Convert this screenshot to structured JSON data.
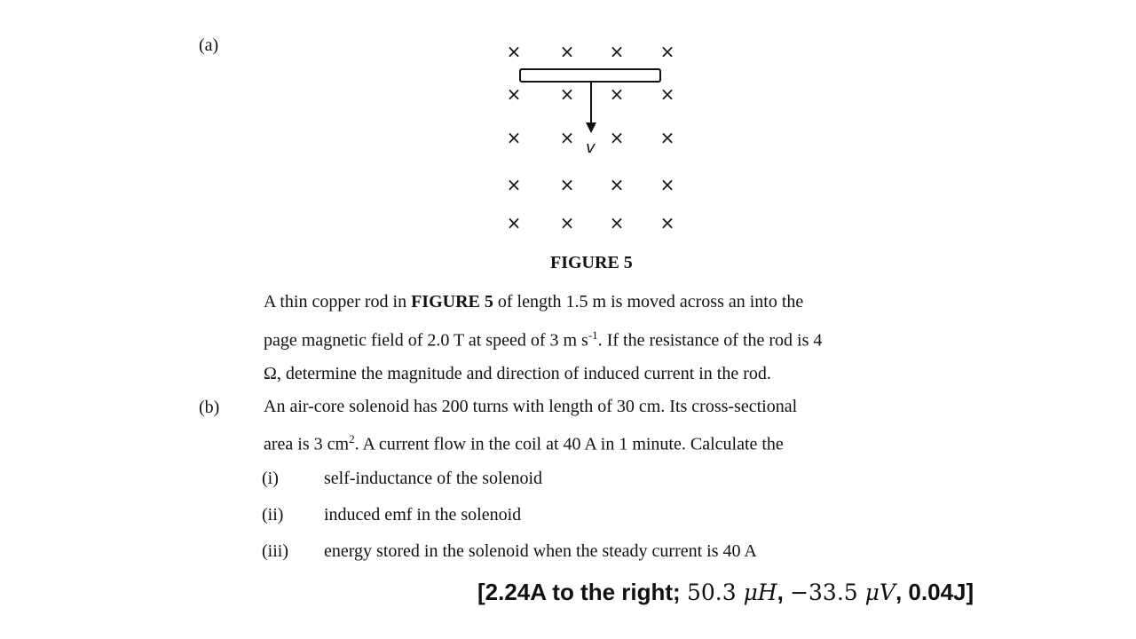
{
  "part_a": {
    "label": "(a)",
    "figure": {
      "caption": "FIGURE 5",
      "cross_symbol": "×",
      "velocity_label": "v",
      "rows": 5,
      "cols": 4
    },
    "question": {
      "line1_pre": "A thin copper rod in ",
      "line1_bold": "FIGURE 5",
      "line1_post": " of length 1.5 m is moved across an into the",
      "line2_pre": "page magnetic field of 2.0 T at speed of 3 m s",
      "line2_sup": "-1",
      "line2_post": ". If the resistance of the rod is 4",
      "line3": "Ω, determine the magnitude and direction of induced current in the rod."
    }
  },
  "part_b": {
    "label": "(b)",
    "line1": "An air-core solenoid has 200 turns with length of 30 cm. Its cross-sectional",
    "line2_pre": "area is 3 cm",
    "line2_sup": "2",
    "line2_post": ". A current flow in the coil at 40 A in 1 minute. Calculate the",
    "items": [
      {
        "num": "(i)",
        "text": "self-inductance of the solenoid"
      },
      {
        "num": "(ii)",
        "text": "induced emf in the solenoid"
      },
      {
        "num": "(iii)",
        "text": "energy stored in the solenoid when the steady current is 40 A"
      }
    ]
  },
  "answer": {
    "open": "[2.24A to the right; ",
    "inductance_num": "50.3",
    "inductance_unit": "μH",
    "sep1": ", ",
    "emf_num": "−33.5",
    "emf_unit": "μV",
    "sep2": ", ",
    "energy": "0.04J]"
  }
}
